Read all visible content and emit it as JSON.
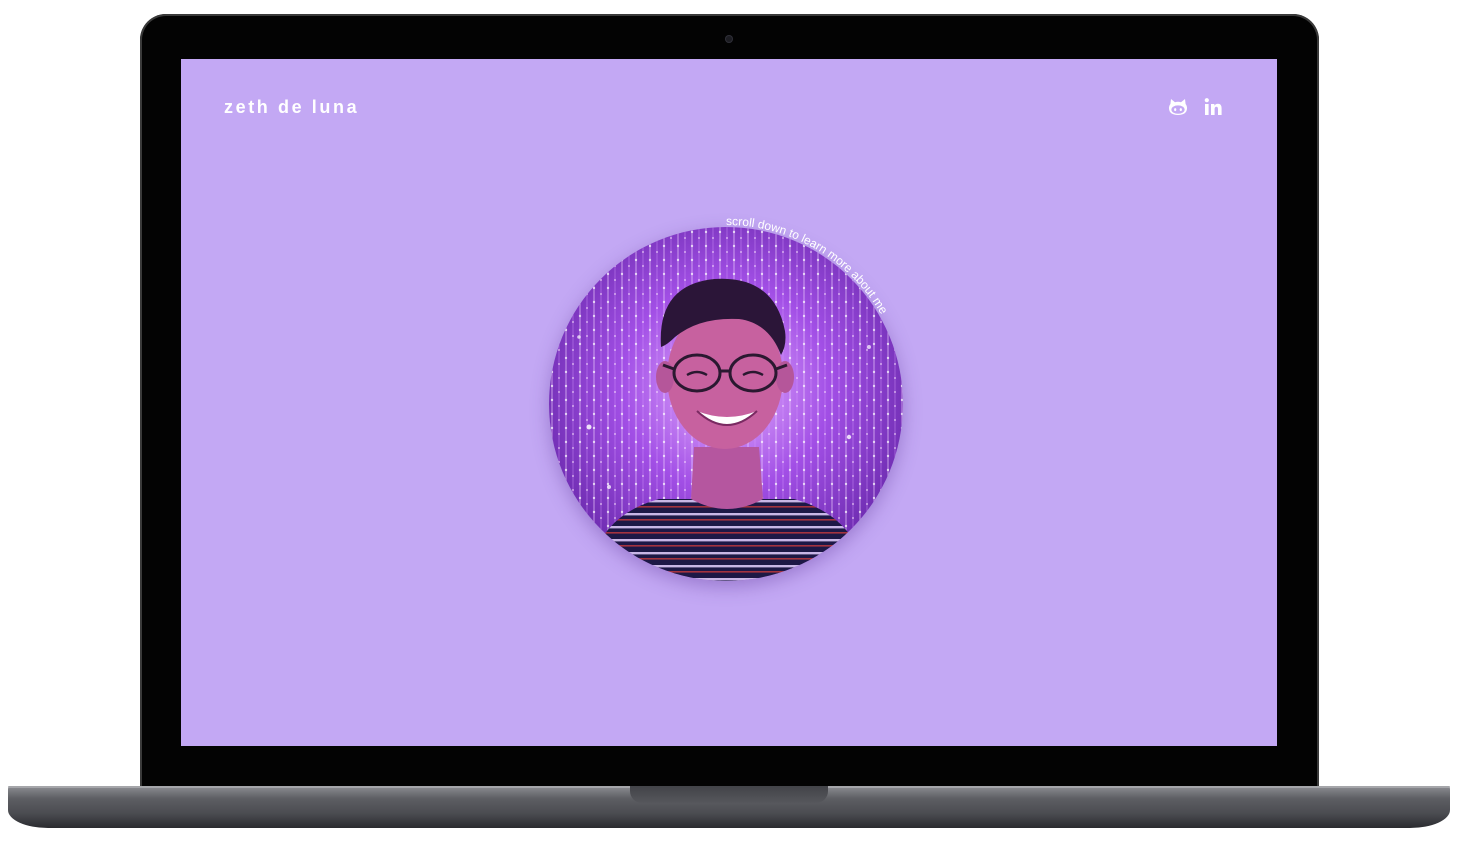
{
  "site": {
    "brand": "zeth de luna",
    "background_color": "#c3a8f4",
    "text_color": "#ffffff"
  },
  "nav": {
    "social": [
      {
        "name": "github",
        "icon": "github-icon"
      },
      {
        "name": "linkedin",
        "icon": "linkedin-icon"
      }
    ]
  },
  "hero": {
    "portrait": {
      "alt": "portrait photo"
    },
    "curved_text": "scroll down to learn more about me"
  }
}
